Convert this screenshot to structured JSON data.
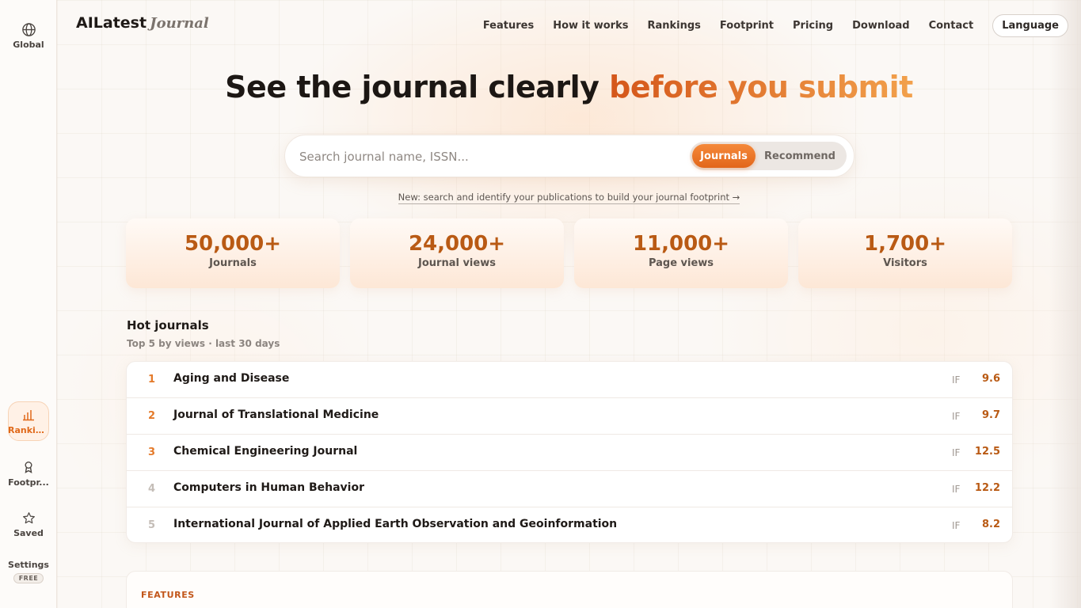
{
  "sidebar": {
    "top": {
      "label": "Global",
      "icon": "globe-icon"
    },
    "items": [
      {
        "label": "Rankin...",
        "icon": "bar-chart-icon",
        "active": true
      },
      {
        "label": "Footpr...",
        "icon": "footprint-pin-icon",
        "active": false
      },
      {
        "label": "Saved",
        "icon": "star-icon",
        "active": false
      }
    ],
    "settings": {
      "label": "Settings",
      "badge": "FREE"
    }
  },
  "header": {
    "logo_main": "AILatest",
    "logo_sub": "Journal",
    "nav": [
      "Features",
      "How it works",
      "Rankings",
      "Footprint",
      "Pricing",
      "Download",
      "Contact"
    ],
    "language_label": "Language"
  },
  "hero": {
    "title_plain": "See the journal clearly",
    "title_accent": "before you submit"
  },
  "search": {
    "placeholder": "Search journal name, ISSN...",
    "value": "",
    "toggle": {
      "selected": "Journals",
      "other": "Recommend"
    }
  },
  "notice": "New: search and identify your publications to build your journal footprint →",
  "stats": [
    {
      "value": "50,000+",
      "label": "Journals"
    },
    {
      "value": "24,000+",
      "label": "Journal views"
    },
    {
      "value": "11,000+",
      "label": "Page views"
    },
    {
      "value": "1,700+",
      "label": "Visitors"
    }
  ],
  "hot": {
    "title": "Hot journals",
    "subtitle": "Top 5 by views · last 30 days",
    "rows": [
      {
        "rank": "1",
        "name": "Aging and Disease",
        "if_label": "IF",
        "if_value": "9.6"
      },
      {
        "rank": "2",
        "name": "Journal of Translational Medicine",
        "if_label": "IF",
        "if_value": "9.7"
      },
      {
        "rank": "3",
        "name": "Chemical Engineering Journal",
        "if_label": "IF",
        "if_value": "12.5"
      },
      {
        "rank": "4",
        "name": "Computers in Human Behavior",
        "if_label": "IF",
        "if_value": "12.2"
      },
      {
        "rank": "5",
        "name": "International Journal of Applied Earth Observation and Geoinformation",
        "if_label": "IF",
        "if_value": "8.2"
      }
    ]
  },
  "features": {
    "label": "FEATURES"
  },
  "colors": {
    "accent": "#e2661a",
    "accent_dark": "#b95a14",
    "background": "#fbf8f5"
  }
}
